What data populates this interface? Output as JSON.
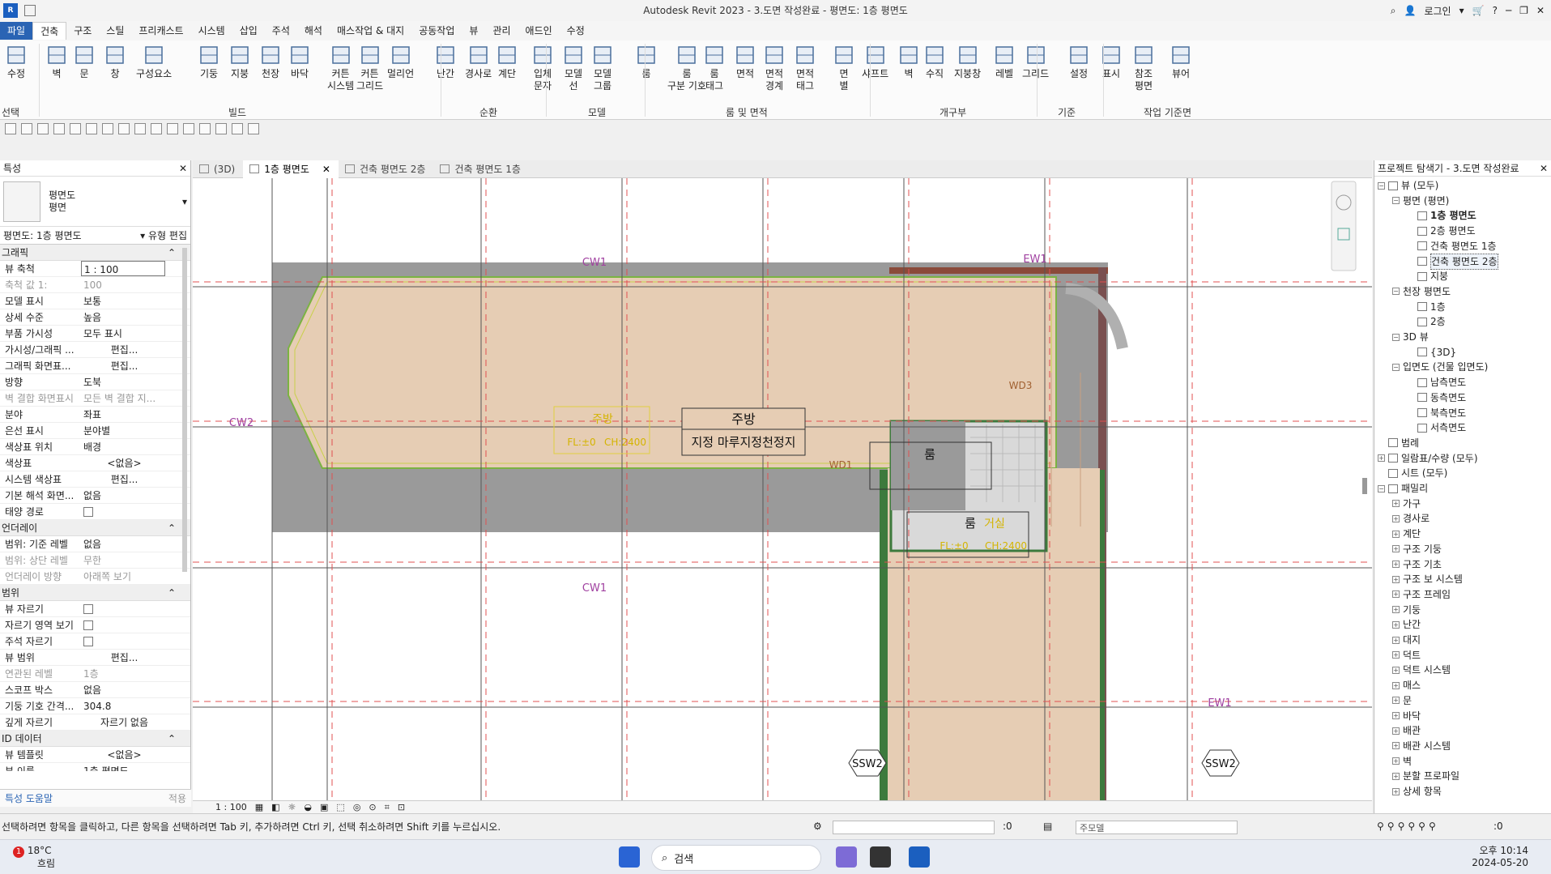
{
  "app": {
    "title": "Autodesk Revit 2023 - 3.도면 작성완료 - 평면도: 1층 평면도",
    "logo": "R",
    "login": "로그인"
  },
  "ribbon_tabs": [
    "파일",
    "건축",
    "구조",
    "스틸",
    "프리캐스트",
    "시스템",
    "삽입",
    "주석",
    "해석",
    "매스작업 & 대지",
    "공동작업",
    "뷰",
    "관리",
    "애드인",
    "수정"
  ],
  "ribbon": {
    "tools": [
      {
        "label": "수정",
        "icon": "cursor-icon"
      },
      {
        "label": "벽",
        "icon": "wall-icon"
      },
      {
        "label": "문",
        "icon": "door-icon"
      },
      {
        "label": "창",
        "icon": "window-icon"
      },
      {
        "label": "구성요소",
        "icon": "component-icon"
      },
      {
        "label": "기둥",
        "icon": "column-icon"
      },
      {
        "label": "지붕",
        "icon": "roof-icon"
      },
      {
        "label": "천장",
        "icon": "ceiling-icon"
      },
      {
        "label": "바닥",
        "icon": "floor-icon"
      },
      {
        "label": "커튼\n시스템",
        "icon": "curtain-system-icon"
      },
      {
        "label": "커튼\n그리드",
        "icon": "curtain-grid-icon"
      },
      {
        "label": "멀리언",
        "icon": "mullion-icon"
      },
      {
        "label": "난간",
        "icon": "railing-icon"
      },
      {
        "label": "경사로",
        "icon": "ramp-icon"
      },
      {
        "label": "계단",
        "icon": "stair-icon"
      },
      {
        "label": "입체\n문자",
        "icon": "model-text-icon"
      },
      {
        "label": "모델\n선",
        "icon": "model-line-icon"
      },
      {
        "label": "모델\n그룹",
        "icon": "model-group-icon"
      },
      {
        "label": "룸",
        "icon": "room-icon"
      },
      {
        "label": "룸\n구분 기호",
        "icon": "room-separator-icon"
      },
      {
        "label": "룸\n태그",
        "icon": "room-tag-icon"
      },
      {
        "label": "면적",
        "icon": "area-icon"
      },
      {
        "label": "면적\n경계",
        "icon": "area-boundary-icon"
      },
      {
        "label": "면적\n태그",
        "icon": "area-tag-icon"
      },
      {
        "label": "면\n별",
        "icon": "by-face-icon"
      },
      {
        "label": "샤프트",
        "icon": "shaft-icon"
      },
      {
        "label": "벽",
        "icon": "wall-opening-icon"
      },
      {
        "label": "수직",
        "icon": "vertical-icon"
      },
      {
        "label": "지붕창",
        "icon": "dormer-icon"
      },
      {
        "label": "레벨",
        "icon": "level-icon"
      },
      {
        "label": "그리드",
        "icon": "grid-icon"
      },
      {
        "label": "설정",
        "icon": "set-icon"
      },
      {
        "label": "표시",
        "icon": "show-icon"
      },
      {
        "label": "참조\n평면",
        "icon": "ref-plane-icon"
      },
      {
        "label": "뷰어",
        "icon": "viewer-icon"
      }
    ],
    "panels": [
      "선택",
      "빌드",
      "순환",
      "모델",
      "룸 및 면적",
      "개구부",
      "기준",
      "작업 기준면"
    ]
  },
  "properties": {
    "title": "특성",
    "type_name": "평면도",
    "type_sub": "평면",
    "view_selector": "평면도: 1층 평면도",
    "edit_type": "유형 편집",
    "groups": [
      {
        "name": "그래픽",
        "rows": [
          [
            "뷰 축척",
            "1 : 100",
            "box"
          ],
          [
            "축척 값    1:",
            "100",
            "grey"
          ],
          [
            "모델 표시",
            "보통",
            ""
          ],
          [
            "상세 수준",
            "높음",
            ""
          ],
          [
            "부품 가시성",
            "모두 표시",
            ""
          ],
          [
            "가시성/그래픽 ...",
            "편집...",
            "btn"
          ],
          [
            "그래픽 화면표...",
            "편집...",
            "btn"
          ],
          [
            "방향",
            "도북",
            ""
          ],
          [
            "벽 결합 화면표시",
            "모든 벽 결합 지...",
            "grey"
          ],
          [
            "분야",
            "좌표",
            ""
          ],
          [
            "은선 표시",
            "분야별",
            ""
          ],
          [
            "색상표 위치",
            "배경",
            ""
          ],
          [
            "색상표",
            "<없음>",
            "btn"
          ],
          [
            "시스템 색상표",
            "편집...",
            "btn"
          ],
          [
            "기본 해석 화면...",
            "없음",
            ""
          ],
          [
            "태양 경로",
            "",
            "chk"
          ]
        ]
      },
      {
        "name": "언더레이",
        "rows": [
          [
            "범위: 기준 레벨",
            "없음",
            ""
          ],
          [
            "범위: 상단 레벨",
            "무한",
            "grey"
          ],
          [
            "언더레이 방향",
            "아래쪽 보기",
            "grey"
          ]
        ]
      },
      {
        "name": "범위",
        "rows": [
          [
            "뷰 자르기",
            "",
            "chk"
          ],
          [
            "자르기 영역 보기",
            "",
            "chk"
          ],
          [
            "주석 자르기",
            "",
            "chk"
          ],
          [
            "뷰 범위",
            "편집...",
            "btn"
          ],
          [
            "연관된 레벨",
            "1층",
            "grey"
          ],
          [
            "스코프 박스",
            "없음",
            ""
          ],
          [
            "기둥 기호 간격...",
            "304.8",
            ""
          ],
          [
            "깊게 자르기",
            "자르기 없음",
            "btn"
          ]
        ]
      },
      {
        "name": "ID 데이터",
        "rows": [
          [
            "뷰 템플릿",
            "<없음>",
            "btn"
          ],
          [
            "뷰 이름",
            "1층 평면도",
            ""
          ]
        ]
      }
    ],
    "help": "특성 도움말",
    "apply": "적용"
  },
  "view_tabs": [
    {
      "label": "(3D)",
      "active": false,
      "close": false
    },
    {
      "label": "1층 평면도",
      "active": true,
      "close": true
    },
    {
      "label": "건축 평면도 2층",
      "active": false,
      "close": false
    },
    {
      "label": "건축 평면도 1층",
      "active": false,
      "close": false
    }
  ],
  "plan": {
    "grid_labels": {
      "cw1_top": "CW1",
      "ew1_top": "EW1",
      "cw2": "CW2",
      "cw1_bot": "CW1",
      "ew1_right": "EW1",
      "ssw2_left": "SSW2",
      "ssw2_right": "SSW2",
      "wd3": "WD3",
      "wd1": "WD1"
    },
    "room_tag_yellow": "주방",
    "room_tag_yellow_sub1": "FL:±0",
    "room_tag_yellow_sub2": "CH:2400",
    "room_tag_main": "주방",
    "room_tag_main_sub": "지정 마루지정천정지",
    "room_tag_room": "룸",
    "room_tag_room2": "룸",
    "room_tag_room2_alt": "거실",
    "room_tag_room2_sub1": "FL:±0",
    "room_tag_room2_sub2": "CH:2400"
  },
  "view_footer": {
    "scale": "1 : 100"
  },
  "browser": {
    "title": "프로젝트 탐색기 - 3.도면 작성완료",
    "items": [
      {
        "label": "뷰 (모두)",
        "level": 0,
        "pm": "-",
        "bold": false
      },
      {
        "label": "평면 (평면)",
        "level": 1,
        "pm": "-",
        "bold": false
      },
      {
        "label": "1층 평면도",
        "level": 2,
        "pm": "",
        "bold": true
      },
      {
        "label": "2층 평면도",
        "level": 2,
        "pm": "",
        "bold": false
      },
      {
        "label": "건축 평면도 1층",
        "level": 2,
        "pm": "",
        "bold": false
      },
      {
        "label": "건축 평면도 2층",
        "level": 2,
        "pm": "",
        "bold": false,
        "boxed": true
      },
      {
        "label": "지붕",
        "level": 2,
        "pm": "",
        "bold": false
      },
      {
        "label": "천장 평면도",
        "level": 1,
        "pm": "-",
        "bold": false
      },
      {
        "label": "1층",
        "level": 2,
        "pm": "",
        "bold": false
      },
      {
        "label": "2층",
        "level": 2,
        "pm": "",
        "bold": false
      },
      {
        "label": "3D 뷰",
        "level": 1,
        "pm": "-",
        "bold": false
      },
      {
        "label": "{3D}",
        "level": 2,
        "pm": "",
        "bold": false
      },
      {
        "label": "입면도 (건물 입면도)",
        "level": 1,
        "pm": "-",
        "bold": false
      },
      {
        "label": "남측면도",
        "level": 2,
        "pm": "",
        "bold": false
      },
      {
        "label": "동측면도",
        "level": 2,
        "pm": "",
        "bold": false
      },
      {
        "label": "북측면도",
        "level": 2,
        "pm": "",
        "bold": false
      },
      {
        "label": "서측면도",
        "level": 2,
        "pm": "",
        "bold": false
      },
      {
        "label": "범례",
        "level": 0,
        "pm": "",
        "bold": false
      },
      {
        "label": "일람표/수량 (모두)",
        "level": 0,
        "pm": "+",
        "bold": false
      },
      {
        "label": "시트 (모두)",
        "level": 0,
        "pm": "",
        "bold": false
      },
      {
        "label": "패밀리",
        "level": 0,
        "pm": "-",
        "bold": false
      },
      {
        "label": "가구",
        "level": 1,
        "pm": "+",
        "bold": false
      },
      {
        "label": "경사로",
        "level": 1,
        "pm": "+",
        "bold": false
      },
      {
        "label": "계단",
        "level": 1,
        "pm": "+",
        "bold": false
      },
      {
        "label": "구조 기둥",
        "level": 1,
        "pm": "+",
        "bold": false
      },
      {
        "label": "구조 기초",
        "level": 1,
        "pm": "+",
        "bold": false
      },
      {
        "label": "구조 보 시스템",
        "level": 1,
        "pm": "+",
        "bold": false
      },
      {
        "label": "구조 프레임",
        "level": 1,
        "pm": "+",
        "bold": false
      },
      {
        "label": "기둥",
        "level": 1,
        "pm": "+",
        "bold": false
      },
      {
        "label": "난간",
        "level": 1,
        "pm": "+",
        "bold": false
      },
      {
        "label": "대지",
        "level": 1,
        "pm": "+",
        "bold": false
      },
      {
        "label": "덕트",
        "level": 1,
        "pm": "+",
        "bold": false
      },
      {
        "label": "덕트 시스템",
        "level": 1,
        "pm": "+",
        "bold": false
      },
      {
        "label": "매스",
        "level": 1,
        "pm": "+",
        "bold": false
      },
      {
        "label": "문",
        "level": 1,
        "pm": "+",
        "bold": false
      },
      {
        "label": "바닥",
        "level": 1,
        "pm": "+",
        "bold": false
      },
      {
        "label": "배관",
        "level": 1,
        "pm": "+",
        "bold": false
      },
      {
        "label": "배관 시스템",
        "level": 1,
        "pm": "+",
        "bold": false
      },
      {
        "label": "벽",
        "level": 1,
        "pm": "+",
        "bold": false
      },
      {
        "label": "분할 프로파일",
        "level": 1,
        "pm": "+",
        "bold": false
      },
      {
        "label": "상세 항목",
        "level": 1,
        "pm": "+",
        "bold": false
      }
    ]
  },
  "status": {
    "message": "선택하려면 항목을 클릭하고, 다른 항목을 선택하려면 Tab 키, 추가하려면 Ctrl 키, 선택 취소하려면 Shift 키를 누르십시오.",
    "count": ":0",
    "model": "주모델",
    "filter_count": ":0"
  },
  "taskbar": {
    "temp": "18°C",
    "weather": "흐림",
    "badge": "1",
    "search": "검색",
    "time": "오후 10:14",
    "date": "2024-05-20"
  },
  "colors": {
    "accent": "#2a64b4",
    "room_fill": "#e6cdb4",
    "wall_grey": "#9a9a9a",
    "grid_purple": "#a040a0",
    "wall_green": "#3d7a3d"
  }
}
